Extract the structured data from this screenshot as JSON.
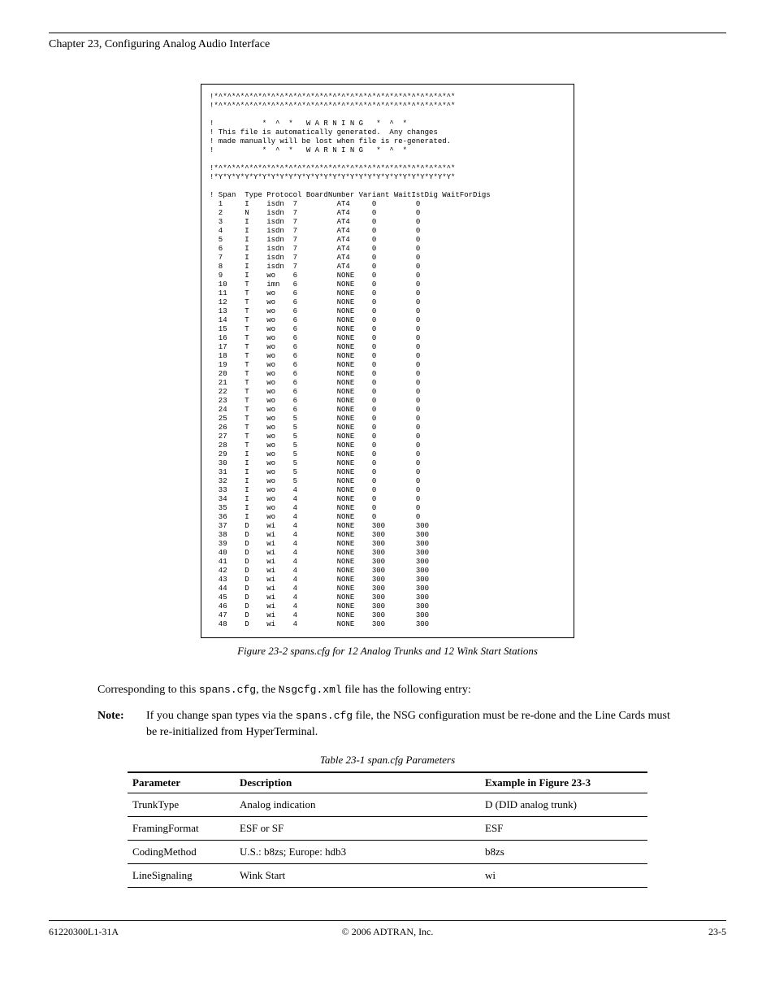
{
  "header": {
    "chapter": "Chapter 23, Configuring Analog Audio Interface"
  },
  "screenshot_box": {
    "rows": [
      [
        "1",
        "I",
        "isdn",
        "7",
        "AT4",
        "0",
        "0"
      ],
      [
        "2",
        "N",
        "isdn",
        "7",
        "AT4",
        "0",
        "0"
      ],
      [
        "3",
        "I",
        "isdn",
        "7",
        "AT4",
        "0",
        "0"
      ],
      [
        "4",
        "I",
        "isdn",
        "7",
        "AT4",
        "0",
        "0"
      ],
      [
        "5",
        "I",
        "isdn",
        "7",
        "AT4",
        "0",
        "0"
      ],
      [
        "6",
        "I",
        "isdn",
        "7",
        "AT4",
        "0",
        "0"
      ],
      [
        "7",
        "I",
        "isdn",
        "7",
        "AT4",
        "0",
        "0"
      ],
      [
        "8",
        "I",
        "isdn",
        "7",
        "AT4",
        "0",
        "0"
      ],
      [
        "9",
        "I",
        "wo",
        "6",
        "NONE",
        "0",
        "0"
      ],
      [
        "10",
        "T",
        "imn",
        "6",
        "NONE",
        "0",
        "0"
      ],
      [
        "11",
        "T",
        "wo",
        "6",
        "NONE",
        "0",
        "0"
      ],
      [
        "12",
        "T",
        "wo",
        "6",
        "NONE",
        "0",
        "0"
      ],
      [
        "13",
        "T",
        "wo",
        "6",
        "NONE",
        "0",
        "0"
      ],
      [
        "14",
        "T",
        "wo",
        "6",
        "NONE",
        "0",
        "0"
      ],
      [
        "15",
        "T",
        "wo",
        "6",
        "NONE",
        "0",
        "0"
      ],
      [
        "16",
        "T",
        "wo",
        "6",
        "NONE",
        "0",
        "0"
      ],
      [
        "17",
        "T",
        "wo",
        "6",
        "NONE",
        "0",
        "0"
      ],
      [
        "18",
        "T",
        "wo",
        "6",
        "NONE",
        "0",
        "0"
      ],
      [
        "19",
        "T",
        "wo",
        "6",
        "NONE",
        "0",
        "0"
      ],
      [
        "20",
        "T",
        "wo",
        "6",
        "NONE",
        "0",
        "0"
      ],
      [
        "21",
        "T",
        "wo",
        "6",
        "NONE",
        "0",
        "0"
      ],
      [
        "22",
        "T",
        "wo",
        "6",
        "NONE",
        "0",
        "0"
      ],
      [
        "23",
        "T",
        "wo",
        "6",
        "NONE",
        "0",
        "0"
      ],
      [
        "24",
        "T",
        "wo",
        "6",
        "NONE",
        "0",
        "0"
      ],
      [
        "25",
        "T",
        "wo",
        "5",
        "NONE",
        "0",
        "0"
      ],
      [
        "26",
        "T",
        "wo",
        "5",
        "NONE",
        "0",
        "0"
      ],
      [
        "27",
        "T",
        "wo",
        "5",
        "NONE",
        "0",
        "0"
      ],
      [
        "28",
        "T",
        "wo",
        "5",
        "NONE",
        "0",
        "0"
      ],
      [
        "29",
        "I",
        "wo",
        "5",
        "NONE",
        "0",
        "0"
      ],
      [
        "30",
        "I",
        "wo",
        "5",
        "NONE",
        "0",
        "0"
      ],
      [
        "31",
        "I",
        "wo",
        "5",
        "NONE",
        "0",
        "0"
      ],
      [
        "32",
        "I",
        "wo",
        "5",
        "NONE",
        "0",
        "0"
      ],
      [
        "33",
        "I",
        "wo",
        "4",
        "NONE",
        "0",
        "0"
      ],
      [
        "34",
        "I",
        "wo",
        "4",
        "NONE",
        "0",
        "0"
      ],
      [
        "35",
        "I",
        "wo",
        "4",
        "NONE",
        "0",
        "0"
      ],
      [
        "36",
        "I",
        "wo",
        "4",
        "NONE",
        "0",
        "0"
      ],
      [
        "37",
        "D",
        "wi",
        "4",
        "NONE",
        "300",
        "300"
      ],
      [
        "38",
        "D",
        "wi",
        "4",
        "NONE",
        "300",
        "300"
      ],
      [
        "39",
        "D",
        "wi",
        "4",
        "NONE",
        "300",
        "300"
      ],
      [
        "40",
        "D",
        "wi",
        "4",
        "NONE",
        "300",
        "300"
      ],
      [
        "41",
        "D",
        "wi",
        "4",
        "NONE",
        "300",
        "300"
      ],
      [
        "42",
        "D",
        "wi",
        "4",
        "NONE",
        "300",
        "300"
      ],
      [
        "43",
        "D",
        "wi",
        "4",
        "NONE",
        "300",
        "300"
      ],
      [
        "44",
        "D",
        "wi",
        "4",
        "NONE",
        "300",
        "300"
      ],
      [
        "45",
        "D",
        "wi",
        "4",
        "NONE",
        "300",
        "300"
      ],
      [
        "46",
        "D",
        "wi",
        "4",
        "NONE",
        "300",
        "300"
      ],
      [
        "47",
        "D",
        "wi",
        "4",
        "NONE",
        "300",
        "300"
      ],
      [
        "48",
        "D",
        "wi",
        "4",
        "NONE",
        "300",
        "300"
      ]
    ],
    "col_header": "! Span  Type Protocol BoardNumber Variant WaitIstDig WaitForDigs"
  },
  "figure_caption": "Figure 23-2 spans.cfg for 12 Analog Trunks and 12 Wink Start Stations",
  "body_paragraph_prefix": "Corresponding to this ",
  "body_paragraph_file1": "spans.cfg",
  "body_paragraph_mid": ", the ",
  "body_paragraph_file2": "Nsgcfg.xml",
  "body_paragraph_suffix": " file has the following entry:",
  "note": {
    "label": "Note:",
    "text_prefix": "If you change span types via the ",
    "file": "spans.cfg",
    "text_suffix": " file, the NSG configuration must be re-done and the Line Cards must be re-initialized from HyperTerminal."
  },
  "table": {
    "caption": "Table 23-1 span.cfg Parameters",
    "headers": [
      "Parameter",
      "Description",
      "Example in Figure 23-3"
    ],
    "rows": [
      [
        "TrunkType",
        "Analog indication",
        "D (DID analog trunk)"
      ],
      [
        "FramingFormat",
        "ESF or SF",
        "ESF"
      ],
      [
        "CodingMethod",
        "U.S.: b8zs; Europe: hdb3",
        "b8zs"
      ],
      [
        "LineSignaling",
        "Wink Start",
        "wi"
      ]
    ]
  },
  "footer": {
    "left": "61220300L1-31A",
    "center": "© 2006 ADTRAN, Inc.",
    "right": "23-5"
  }
}
